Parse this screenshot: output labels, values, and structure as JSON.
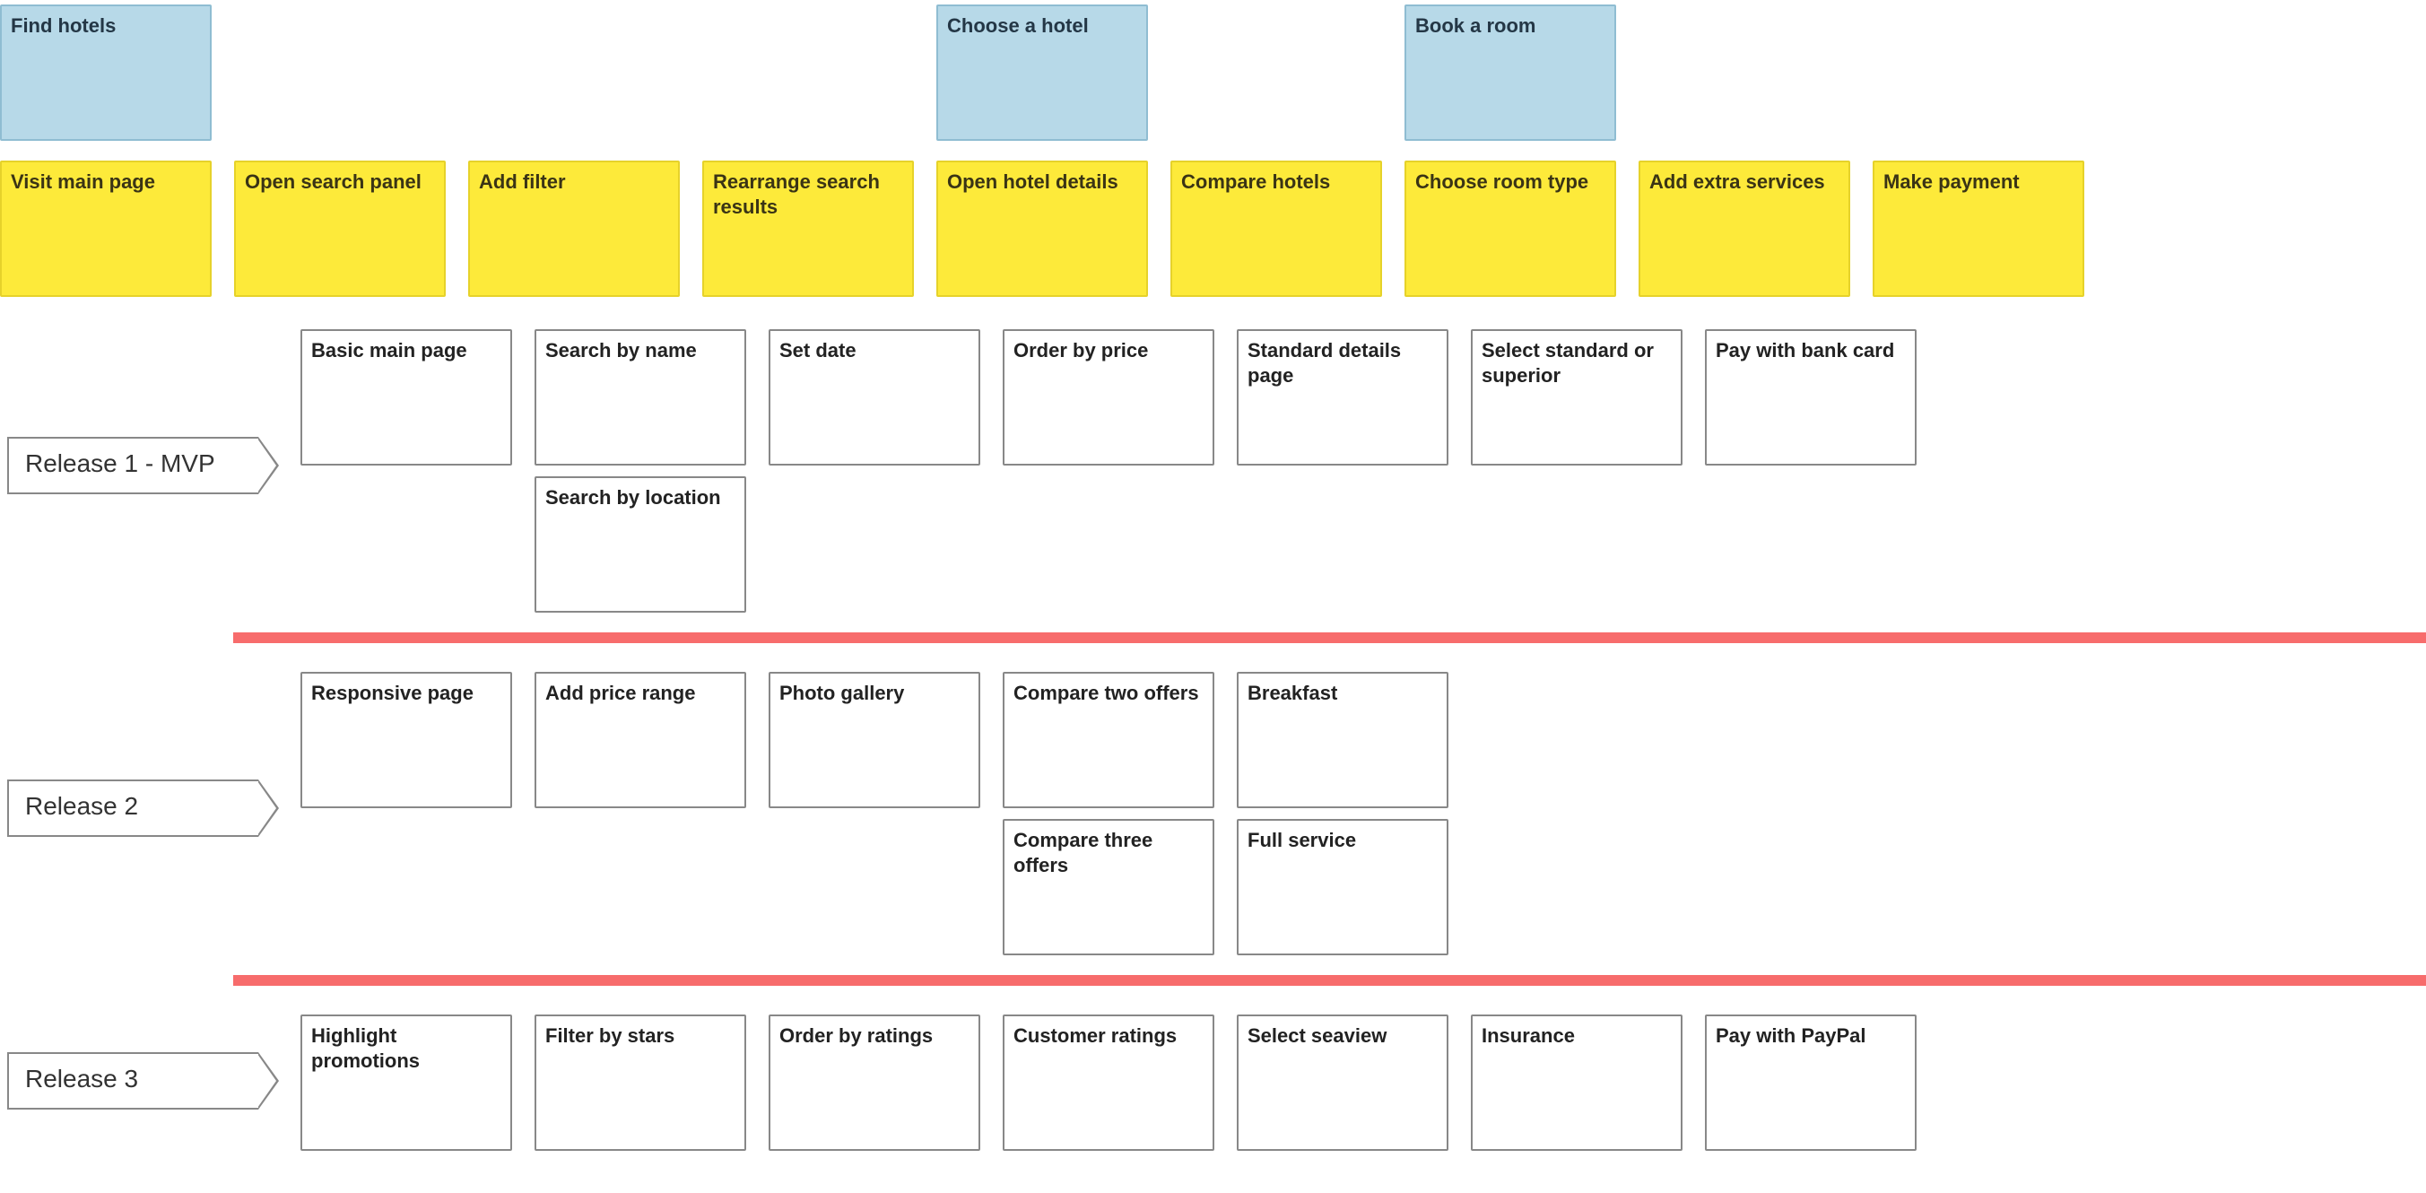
{
  "epics": [
    "Find hotels",
    "",
    "",
    "",
    "Choose a hotel",
    "",
    "Book a room",
    "",
    ""
  ],
  "features": [
    "Visit main page",
    "Open search panel",
    "Add filter",
    "Rearrange search results",
    "Open hotel details",
    "Compare hotels",
    "Choose room type",
    "Add extra services",
    "Make payment"
  ],
  "releases": [
    {
      "label": "Release 1 - MVP",
      "columns": [
        [
          "Basic main page"
        ],
        [
          "Search by name",
          "Search by location"
        ],
        [
          "Set date"
        ],
        [
          "Order by price"
        ],
        [
          "Standard details page"
        ],
        [],
        [
          "Select standard or superior"
        ],
        [],
        [
          "Pay with bank card"
        ]
      ]
    },
    {
      "label": "Release 2",
      "columns": [
        [
          "Responsive page"
        ],
        [],
        [
          "Add price range"
        ],
        [],
        [
          "Photo gallery"
        ],
        [
          "Compare two offers",
          "Compare three offers"
        ],
        [],
        [
          "Breakfast",
          "Full service"
        ],
        []
      ]
    },
    {
      "label": "Release 3",
      "columns": [
        [
          "Highlight promotions"
        ],
        [],
        [
          "Filter by stars"
        ],
        [
          "Order by ratings"
        ],
        [
          "Customer ratings"
        ],
        [],
        [
          "Select seaview"
        ],
        [
          "Insurance"
        ],
        [
          "Pay with PayPal"
        ]
      ]
    }
  ]
}
